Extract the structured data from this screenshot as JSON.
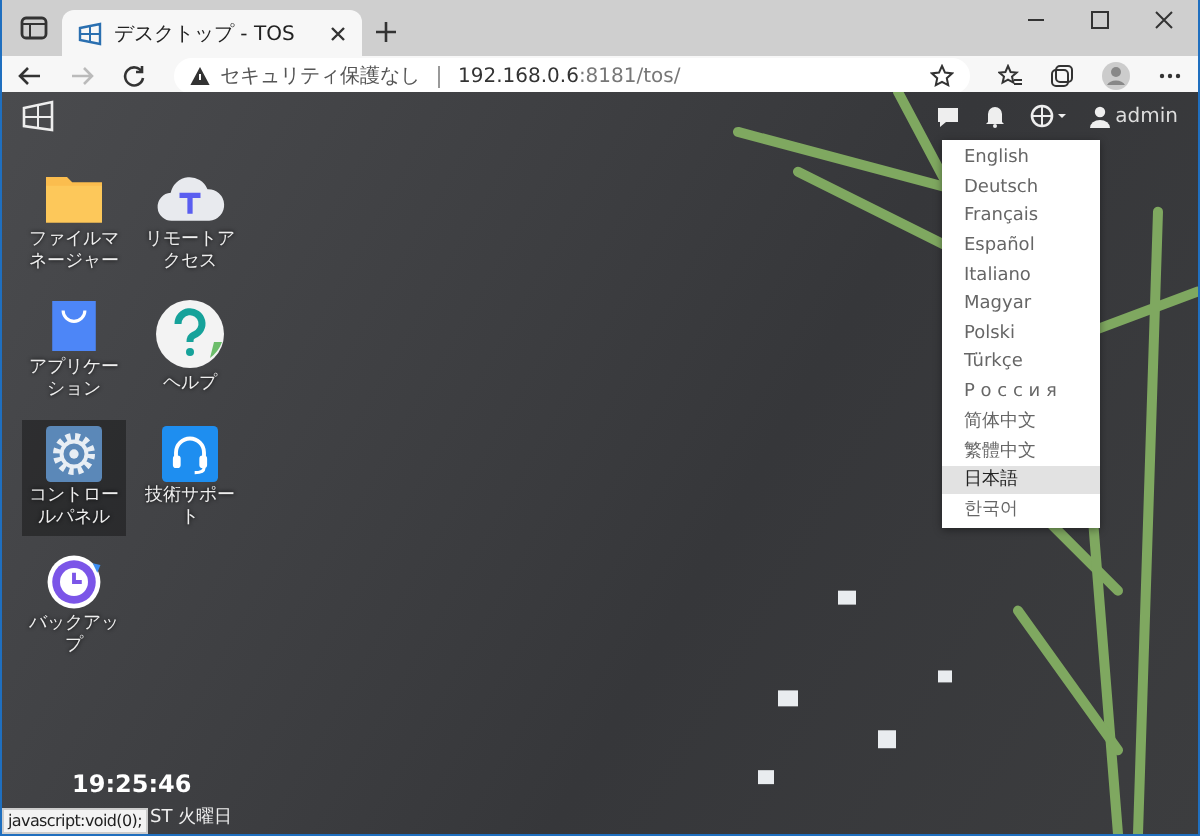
{
  "browser": {
    "tabs": [
      {
        "title": "デスクトップ - TOS",
        "selected": true
      }
    ],
    "address": {
      "security": "セキュリティ保護なし",
      "host": "192.168.0.6",
      "rest": ":8181/tos/"
    }
  },
  "top_bar": {
    "user": "admin"
  },
  "desktop_icons": [
    {
      "kind": "folder",
      "label": "ファイルマネージャー",
      "selected": false
    },
    {
      "kind": "cloud",
      "label": "リモートアクセス",
      "selected": false
    },
    {
      "kind": "bag",
      "label": "アプリケーション",
      "selected": false
    },
    {
      "kind": "help",
      "label": "ヘルプ",
      "selected": false
    },
    {
      "kind": "gear",
      "label": "コントロールパネル",
      "selected": true
    },
    {
      "kind": "headset",
      "label": "技術サポート",
      "selected": false
    },
    {
      "kind": "clock",
      "label": "バックアップ",
      "selected": false
    }
  ],
  "language_menu": [
    {
      "label": "English",
      "selected": false
    },
    {
      "label": "Deutsch",
      "selected": false
    },
    {
      "label": "Français",
      "selected": false
    },
    {
      "label": "Español",
      "selected": false
    },
    {
      "label": "Italiano",
      "selected": false
    },
    {
      "label": "Magyar",
      "selected": false
    },
    {
      "label": "Polski",
      "selected": false
    },
    {
      "label": "Türkçe",
      "selected": false
    },
    {
      "label": "Р о с с и я",
      "selected": false
    },
    {
      "label": "简体中文",
      "selected": false
    },
    {
      "label": "繁體中文",
      "selected": false
    },
    {
      "label": "日本語",
      "selected": true
    },
    {
      "label": "한국어",
      "selected": false
    }
  ],
  "clock": {
    "time": "19:25:46",
    "date": "ST 火曜日"
  },
  "status_bar": "javascript:void(0);"
}
